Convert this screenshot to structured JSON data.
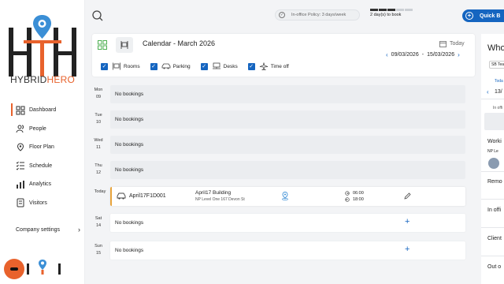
{
  "brand": {
    "hybrid": "HYBRID",
    "hero": "HERO",
    "accent": "#e8622c",
    "primary": "#1565c0"
  },
  "sidebar": {
    "items": [
      {
        "label": "Dashboard",
        "icon": "dashboard-icon",
        "active": true
      },
      {
        "label": "People",
        "icon": "people-icon"
      },
      {
        "label": "Floor Plan",
        "icon": "floor-plan-icon"
      },
      {
        "label": "Schedule",
        "icon": "schedule-icon"
      },
      {
        "label": "Analytics",
        "icon": "analytics-icon"
      },
      {
        "label": "Visitors",
        "icon": "visitors-icon"
      }
    ],
    "company_settings": "Company settings"
  },
  "topbar": {
    "policy_text": "In-office Policy: 3 days/week",
    "days_text": "2 day(s) to book",
    "days_progress": {
      "filled": 3,
      "total": 5
    },
    "quick_label": "Quick B"
  },
  "calendar": {
    "title": "Calendar - March 2026",
    "today_label": "Today",
    "range_start": "09/03/2026",
    "range_sep": "-",
    "range_end": "15/03/2026",
    "filters": [
      "Rooms",
      "Parking",
      "Desks",
      "Time off"
    ],
    "days": [
      {
        "day": "Mon",
        "num": "09",
        "status": "No bookings"
      },
      {
        "day": "Tue",
        "num": "10",
        "status": "No bookings"
      },
      {
        "day": "Wed",
        "num": "11",
        "status": "No bookings"
      },
      {
        "day": "Thu",
        "num": "12",
        "status": "No bookings"
      },
      {
        "day": "Today",
        "num": ""
      },
      {
        "day": "Sat",
        "num": "14",
        "status": "No bookings",
        "add": "+"
      },
      {
        "day": "Sun",
        "num": "15",
        "status": "No bookings",
        "add": "+"
      }
    ],
    "booking": {
      "id": "April17F1D001",
      "building": "April17 Building",
      "address": "NP Level One 167 Devon St",
      "start": "06:00",
      "end": "18:00"
    }
  },
  "right_panel": {
    "title": "Who",
    "tag": "SB Tea",
    "today_short": "Toda",
    "date_short": "13/",
    "in_office_short": "In offi",
    "working_short": "Worki",
    "np_short": "NP Le",
    "remote_short": "Remo",
    "in_office2_short": "In offi",
    "client_short": "Client",
    "out_short": "Out o"
  }
}
